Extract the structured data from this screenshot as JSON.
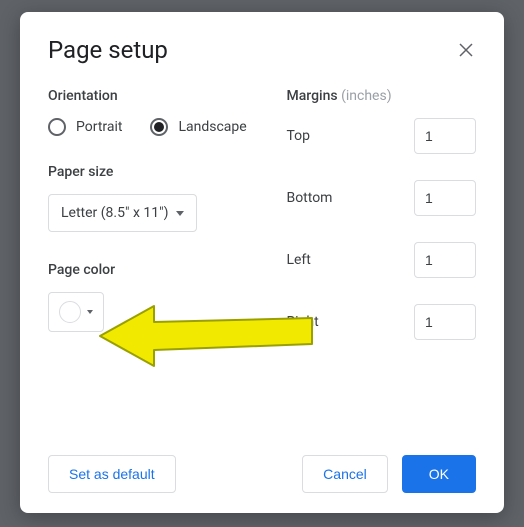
{
  "dialog": {
    "title": "Page setup",
    "orientation_label": "Orientation",
    "orient_portrait": "Portrait",
    "orient_landscape": "Landscape",
    "orientation_selected": "Landscape",
    "paper_size_label": "Paper size",
    "paper_size_value": "Letter (8.5\" x 11\")",
    "page_color_label": "Page color",
    "page_color_value": "#ffffff",
    "margins_label": "Margins",
    "margins_unit": "(inches)",
    "margins": {
      "top_label": "Top",
      "top_value": "1",
      "bottom_label": "Bottom",
      "bottom_value": "1",
      "left_label": "Left",
      "left_value": "1",
      "right_label": "Right",
      "right_value": "1"
    },
    "buttons": {
      "set_default": "Set as default",
      "cancel": "Cancel",
      "ok": "OK"
    }
  },
  "annotation": {
    "arrow_color": "#f2e900"
  }
}
